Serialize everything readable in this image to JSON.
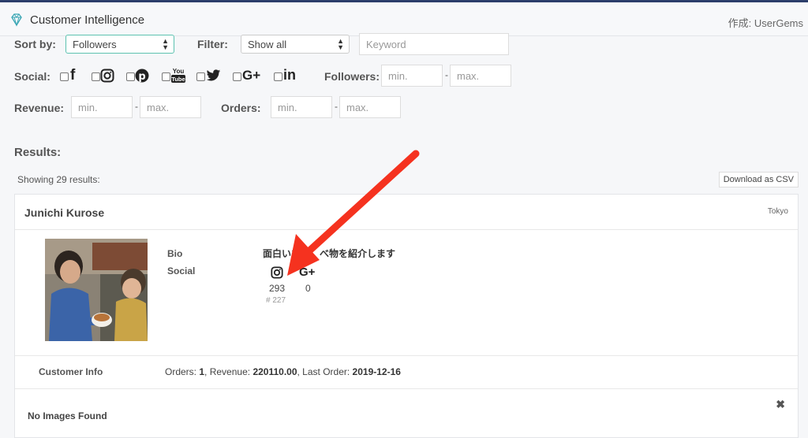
{
  "header": {
    "title": "Customer Intelligence",
    "author": "作成: UserGems"
  },
  "filters": {
    "sort_label": "Sort by:",
    "sort_value": "Followers",
    "filter_label": "Filter:",
    "filter_value": "Show all",
    "keyword_placeholder": "Keyword",
    "social_label": "Social:",
    "followers_label": "Followers:",
    "revenue_label": "Revenue:",
    "orders_label": "Orders:",
    "min_placeholder": "min.",
    "max_placeholder": "max.",
    "dash": "-"
  },
  "social_icons": [
    "facebook-icon",
    "instagram-icon",
    "pinterest-icon",
    "youtube-icon",
    "twitter-icon",
    "google-plus-icon",
    "linkedin-icon"
  ],
  "results": {
    "title": "Results:",
    "showing": "Showing 29 results:",
    "download_label": "Download as CSV"
  },
  "customer": {
    "name": "Junichi Kurose",
    "location": "Tokyo",
    "bio_label": "Bio",
    "bio": "面白いも　　べ物を紹介します",
    "social_label": "Social",
    "instagram_count": "293",
    "instagram_sub": "# 227",
    "google_count": "0",
    "info_label": "Customer Info",
    "info": {
      "orders_label": "Orders:",
      "orders": "1",
      "revenue_label": "Revenue:",
      "revenue": "220110.00",
      "last_order_label": "Last Order:",
      "last_order": "2019-12-16"
    },
    "no_images": "No Images Found"
  },
  "colors": {
    "accent": "#5cc2b0",
    "topbar": "#2c3e6b",
    "arrow": "#f5321f"
  }
}
